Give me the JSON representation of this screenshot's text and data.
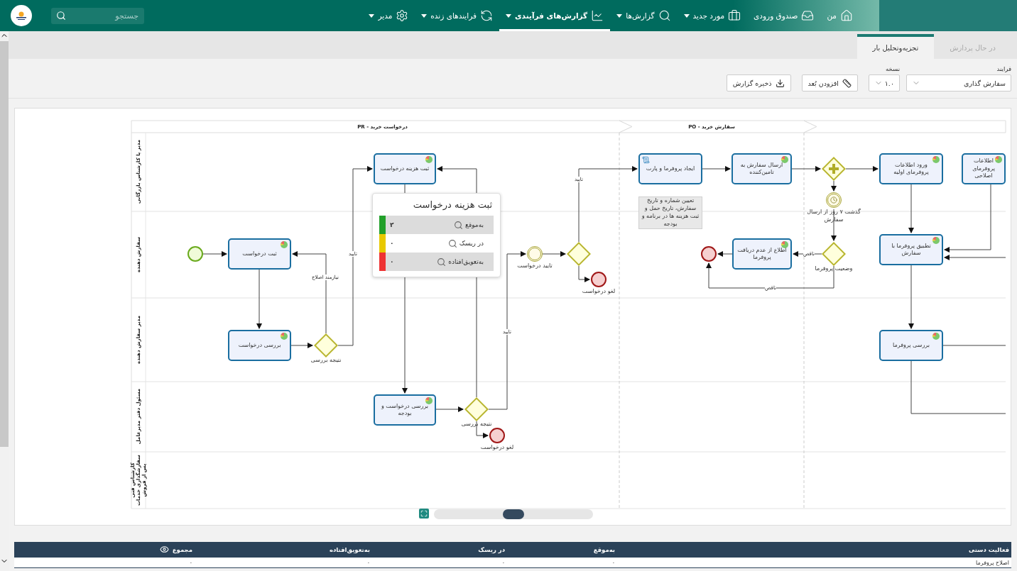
{
  "nav": {
    "items": [
      {
        "label": "من",
        "dropdown": false,
        "selected": false
      },
      {
        "label": "صندوق ورودی",
        "dropdown": false,
        "selected": false
      },
      {
        "label": "مورد جدید",
        "dropdown": true,
        "selected": false
      },
      {
        "label": "گزارش‌ها",
        "dropdown": true,
        "selected": false
      },
      {
        "label": "گزارش‌های فرآیندی",
        "dropdown": true,
        "selected": true
      },
      {
        "label": "فرایندهای زنده",
        "dropdown": true,
        "selected": false
      },
      {
        "label": "مدیر",
        "dropdown": true,
        "selected": false
      }
    ],
    "search": {
      "placeholder": "جستجو"
    }
  },
  "tabs": [
    {
      "label": "در حال پردازش",
      "selected": false
    },
    {
      "label": "تجزیه‌وتحلیل بار",
      "selected": true
    }
  ],
  "toolbar": {
    "process": {
      "label": "فرایند",
      "value": "سفارش گذاری"
    },
    "version": {
      "label": "نسخه",
      "value": "۱.۰"
    },
    "buttons": [
      "افزودن بُعد",
      "ذخیره گزارش"
    ]
  },
  "diagram": {
    "phases": [
      {
        "title": "سفارش خرید - PO"
      },
      {
        "title": "درخواست خرید - PR"
      }
    ],
    "lanes": [
      {
        "label": "مدیر یا کارشناس بازرگانی"
      },
      {
        "label": "سفارش دهنده"
      },
      {
        "label": "مدیر سفارش دهنده"
      },
      {
        "label": "مسئول دفتر مدیرعامل"
      },
      {
        "label": "کارشناس فنی سفارشگذاری خدمات پس از فروش"
      }
    ],
    "nodes": [
      {
        "kind": "start"
      },
      {
        "kind": "task",
        "label": "ثبت درخواست"
      },
      {
        "kind": "task",
        "label": "بررسی درخواست"
      },
      {
        "kind": "gateway",
        "label": "نتیجه بررسی"
      },
      {
        "kind": "task",
        "label": "ثبت هزینه درخواست"
      },
      {
        "kind": "task",
        "label": "بررسی درخواست و بودجه"
      },
      {
        "kind": "gateway",
        "label": "نتیجه بررسی"
      },
      {
        "kind": "end",
        "label": "لغو درخواست"
      },
      {
        "kind": "intermediate",
        "label": "تایید درخواست"
      },
      {
        "kind": "gateway"
      },
      {
        "kind": "end",
        "label": "لغو درخواست"
      },
      {
        "kind": "script-task",
        "label": "ایجاد پروفرما و پارت"
      },
      {
        "kind": "annotation",
        "label": "تعیین شماره و تاریخ سفارش، تاریخ حمل و ثبت هزینه ها در برنامه و بودجه"
      },
      {
        "kind": "task",
        "label": "ارسال سفارش به تامین‌کننده"
      },
      {
        "kind": "parallel"
      },
      {
        "kind": "timer",
        "label": "گذشت ۷ روز از ارسال سفارش"
      },
      {
        "kind": "gateway",
        "label": "وضعیت پروفرما"
      },
      {
        "kind": "task",
        "label": "اطلاع از عدم دریافت پروفرما"
      },
      {
        "kind": "end"
      },
      {
        "kind": "task",
        "label": "اطلاعات پروفرمای اصلاحی"
      },
      {
        "kind": "task",
        "label": "ورود اطلاعات پروفرمای اولیه"
      },
      {
        "kind": "task",
        "label": "تطبیق پروفرما با سفارش"
      },
      {
        "kind": "task",
        "label": "بررسی پروفرما"
      }
    ],
    "edge_labels": [
      "نیازمند اصلاح",
      "تایید",
      "تایید",
      "تایید",
      "ناقص",
      "ناقص"
    ],
    "tooltip": {
      "title": "ثبت هزینه درخواست",
      "rows": [
        {
          "label": "به‌موقع",
          "value": "۲",
          "color": "#22a02a"
        },
        {
          "label": "در ریسک",
          "value": "۰",
          "color": "#e8c800"
        },
        {
          "label": "به‌تعویق‌افتاده",
          "value": "۰",
          "color": "#ee3333"
        }
      ]
    }
  },
  "table": {
    "columns": [
      "فعالیت دستی",
      "به‌موقع",
      "در ریسک",
      "به‌تعویق‌افتاده",
      "مجموع"
    ],
    "rows": [
      {
        "cells": [
          "اصلاح پروفرما",
          "۰",
          "۰",
          "۰",
          "۰"
        ]
      }
    ]
  }
}
